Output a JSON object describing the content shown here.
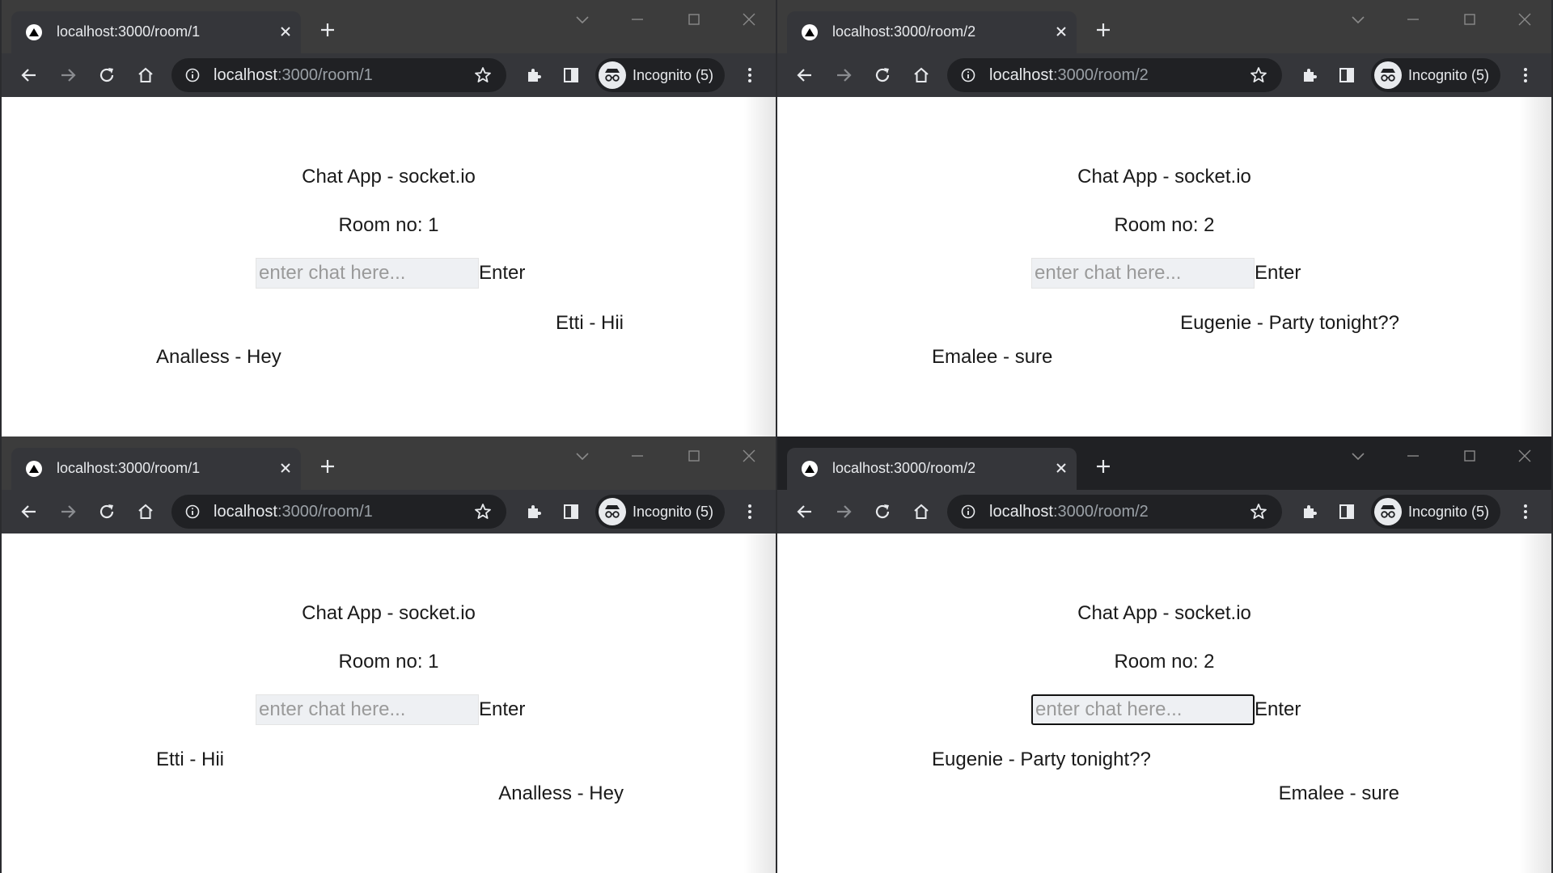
{
  "windows": [
    {
      "tab_title": "localhost:3000/room/1",
      "url_host": "localhost",
      "url_path": ":3000/room/1",
      "profile_label": "Incognito (5)",
      "app_title": "Chat App - socket.io",
      "room_label": "Room no: 1",
      "input_placeholder": "enter chat here...",
      "enter_label": "Enter",
      "messages": [
        {
          "text": "Etti - Hii",
          "side": "right"
        },
        {
          "text": "Analless - Hey",
          "side": "left"
        }
      ]
    },
    {
      "tab_title": "localhost:3000/room/2",
      "url_host": "localhost",
      "url_path": ":3000/room/2",
      "profile_label": "Incognito (5)",
      "app_title": "Chat App - socket.io",
      "room_label": "Room no: 2",
      "input_placeholder": "enter chat here...",
      "enter_label": "Enter",
      "messages": [
        {
          "text": "Eugenie - Party tonight??",
          "side": "right"
        },
        {
          "text": "Emalee - sure",
          "side": "left"
        }
      ]
    },
    {
      "tab_title": "localhost:3000/room/1",
      "url_host": "localhost",
      "url_path": ":3000/room/1",
      "profile_label": "Incognito (5)",
      "app_title": "Chat App - socket.io",
      "room_label": "Room no: 1",
      "input_placeholder": "enter chat here...",
      "enter_label": "Enter",
      "messages": [
        {
          "text": "Etti - Hii",
          "side": "left"
        },
        {
          "text": "Analless - Hey",
          "side": "right"
        }
      ]
    },
    {
      "tab_title": "localhost:3000/room/2",
      "url_host": "localhost",
      "url_path": ":3000/room/2",
      "profile_label": "Incognito (5)",
      "app_title": "Chat App - socket.io",
      "room_label": "Room no: 2",
      "input_placeholder": "enter chat here...",
      "enter_label": "Enter",
      "messages": [
        {
          "text": "Eugenie - Party tonight??",
          "side": "left"
        },
        {
          "text": "Emalee - sure",
          "side": "right"
        }
      ]
    }
  ],
  "icons": {
    "favicon": "triangle-favicon-icon",
    "back": "arrow-left-icon",
    "forward": "arrow-right-icon",
    "reload": "reload-icon",
    "home": "home-icon",
    "info": "info-icon",
    "bookmark": "star-icon",
    "extensions": "puzzle-icon",
    "side_panel": "side-panel-icon",
    "incognito": "incognito-icon",
    "menu": "kebab-menu-icon"
  },
  "colors": {
    "tabstrip_inactive": "#3c3c3c",
    "tabstrip_active": "#202124",
    "toolbar": "#35363a",
    "omnibox": "#202124",
    "page_bg": "#ffffff",
    "text": "#1a1a1a"
  }
}
